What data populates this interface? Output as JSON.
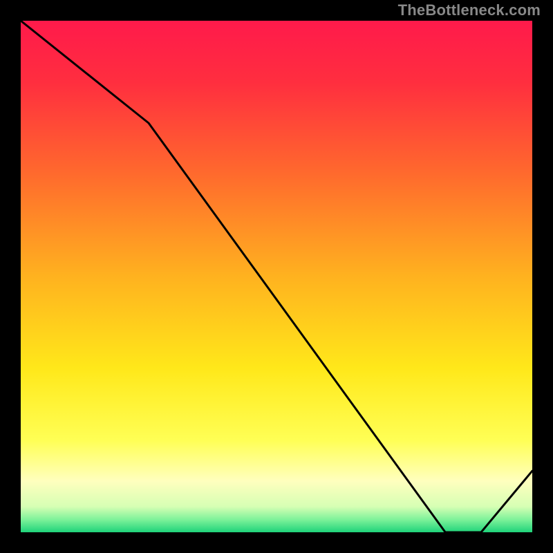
{
  "watermark": "TheBottleneck.com",
  "sweet_spot_label": "",
  "chart_data": {
    "type": "line",
    "title": "",
    "xlabel": "",
    "ylabel": "",
    "xlim": [
      0,
      100
    ],
    "ylim": [
      0,
      100
    ],
    "grid": false,
    "x": [
      0,
      25,
      83,
      90,
      100
    ],
    "values": [
      100,
      80,
      0,
      0,
      12
    ],
    "sweet_spot_range_x": [
      83,
      90
    ],
    "background_gradient": {
      "type": "vertical",
      "stops": [
        {
          "pos": 0.0,
          "color": "#ff1a4b"
        },
        {
          "pos": 0.12,
          "color": "#ff2e3f"
        },
        {
          "pos": 0.3,
          "color": "#ff6a2d"
        },
        {
          "pos": 0.5,
          "color": "#ffb21f"
        },
        {
          "pos": 0.68,
          "color": "#ffe81a"
        },
        {
          "pos": 0.82,
          "color": "#ffff55"
        },
        {
          "pos": 0.9,
          "color": "#ffffbe"
        },
        {
          "pos": 0.95,
          "color": "#d6ffb4"
        },
        {
          "pos": 0.975,
          "color": "#7ef29a"
        },
        {
          "pos": 1.0,
          "color": "#1fd37a"
        }
      ]
    },
    "line_color": "#000000",
    "line_width": 3
  }
}
